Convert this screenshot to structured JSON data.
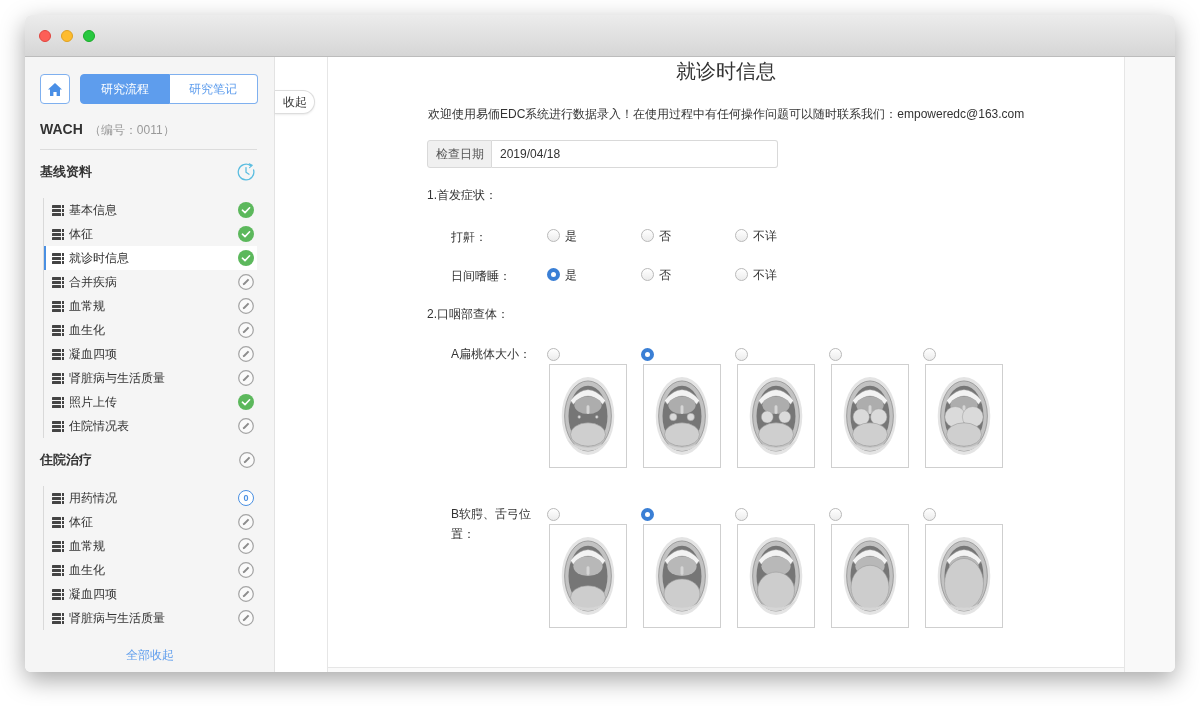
{
  "sidebar": {
    "tabs": [
      {
        "label": "研究流程",
        "selected": true
      },
      {
        "label": "研究笔记",
        "selected": false
      }
    ],
    "study": {
      "name": "WACH",
      "number": "（编号：0011）"
    },
    "sections": [
      {
        "title": "基线资料",
        "kind": "clock",
        "items": [
          {
            "label": "基本信息",
            "kind": "done",
            "selected": false
          },
          {
            "label": "体征",
            "kind": "done",
            "selected": false
          },
          {
            "label": "就诊时信息",
            "kind": "done",
            "selected": true
          },
          {
            "label": "合并疾病",
            "kind": "edit",
            "selected": false
          },
          {
            "label": "血常规",
            "kind": "edit",
            "selected": false
          },
          {
            "label": "血生化",
            "kind": "edit",
            "selected": false
          },
          {
            "label": "凝血四项",
            "kind": "edit",
            "selected": false
          },
          {
            "label": "肾脏病与生活质量",
            "kind": "edit",
            "selected": false
          },
          {
            "label": "照片上传",
            "kind": "done",
            "selected": false
          },
          {
            "label": "住院情况表",
            "kind": "edit",
            "selected": false
          }
        ]
      },
      {
        "title": "住院治疗",
        "kind": "edit",
        "items": [
          {
            "label": "用药情况",
            "kind": "count",
            "count": "0",
            "selected": false
          },
          {
            "label": "体征",
            "kind": "edit",
            "selected": false
          },
          {
            "label": "血常规",
            "kind": "edit",
            "selected": false
          },
          {
            "label": "血生化",
            "kind": "edit",
            "selected": false
          },
          {
            "label": "凝血四项",
            "kind": "edit",
            "selected": false
          },
          {
            "label": "肾脏病与生活质量",
            "kind": "edit",
            "selected": false
          }
        ]
      }
    ],
    "collapse_all": "全部收起"
  },
  "collapse_tab": "收起",
  "form": {
    "title": "就诊时信息",
    "notice": "欢迎使用易侕EDC系统进行数据录入！在使用过程中有任何操作问题可以随时联系我们：empoweredc@163.com",
    "date_field": {
      "label": "检查日期",
      "value": "2019/04/18"
    },
    "sections": [
      {
        "title": "1.首发症状：",
        "questions": [
          {
            "kind": "radio",
            "label": "打鼾：",
            "options": [
              {
                "label": "是",
                "selected": false
              },
              {
                "label": "否",
                "selected": false
              },
              {
                "label": "不详",
                "selected": false
              }
            ]
          },
          {
            "kind": "radio",
            "label": "日间嗜睡：",
            "options": [
              {
                "label": "是",
                "selected": true
              },
              {
                "label": "否",
                "selected": false
              },
              {
                "label": "不详",
                "selected": false
              }
            ]
          }
        ]
      },
      {
        "title": "2.口咽部查体：",
        "questions": [
          {
            "kind": "image",
            "label": "A扁桃体大小：",
            "options": [
              {
                "selected": false
              },
              {
                "selected": true
              },
              {
                "selected": false
              },
              {
                "selected": false
              },
              {
                "selected": false
              }
            ]
          },
          {
            "kind": "image",
            "label": "B软腭、舌弓位置：",
            "options": [
              {
                "selected": false
              },
              {
                "selected": true
              },
              {
                "selected": false
              },
              {
                "selected": false
              },
              {
                "selected": false
              }
            ]
          }
        ]
      }
    ]
  }
}
